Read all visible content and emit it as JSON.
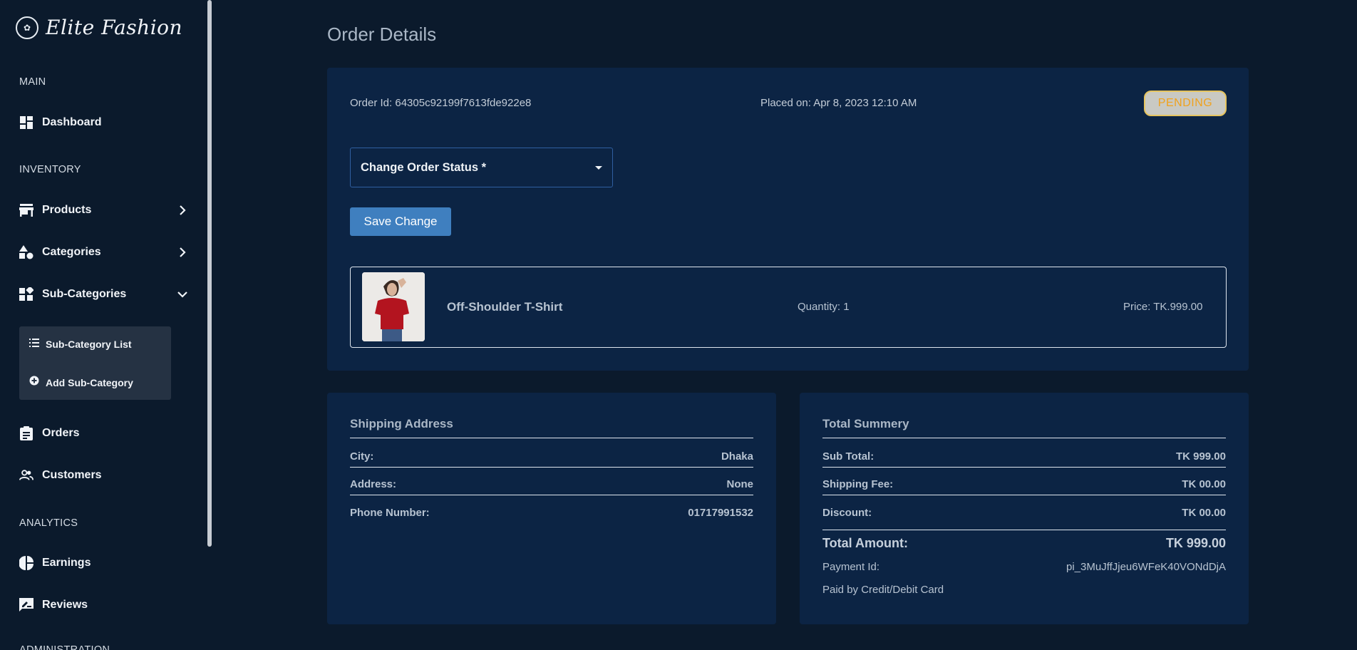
{
  "brand": {
    "name": "Elite Fashion"
  },
  "sidebar": {
    "sections": [
      "MAIN",
      "INVENTORY",
      "ANALYTICS",
      "ADMINISTRATION"
    ],
    "items": {
      "dashboard": "Dashboard",
      "products": "Products",
      "categories": "Categories",
      "subcategories": "Sub-Categories",
      "orders": "Orders",
      "customers": "Customers",
      "earnings": "Earnings",
      "reviews": "Reviews"
    },
    "submenu": {
      "list": "Sub-Category List",
      "add": "Add Sub-Category"
    }
  },
  "page": {
    "title": "Order Details"
  },
  "order": {
    "id_label": "Order Id: 64305c92199f7613fde922e8",
    "placed_label": "Placed on: Apr 8, 2023 12:10 AM",
    "status": "PENDING",
    "status_select_label": "Change Order Status *",
    "save_label": "Save Change",
    "item": {
      "name": "Off-Shoulder T-Shirt",
      "quantity": "Quantity: 1",
      "price": "Price: TK.999.00"
    }
  },
  "shipping": {
    "title": "Shipping Address",
    "rows": [
      {
        "label": "City:",
        "value": "Dhaka"
      },
      {
        "label": "Address:",
        "value": "None"
      },
      {
        "label": "Phone Number:",
        "value": "01717991532"
      }
    ]
  },
  "summary": {
    "title": "Total Summery",
    "rows": [
      {
        "label": "Sub Total:",
        "value": "TK 999.00"
      },
      {
        "label": "Shipping Fee:",
        "value": "TK 00.00"
      },
      {
        "label": "Discount:",
        "value": "TK 00.00"
      }
    ],
    "total_label": "Total Amount:",
    "total_value": "TK 999.00",
    "payment_label": "Payment Id:",
    "payment_value": "pi_3MuJffJjeu6WFeK40VONdDjA",
    "paid_by": "Paid by Credit/Debit Card"
  },
  "colors": {
    "background": "#0b1a2c",
    "card": "#0c2444",
    "accent_button": "#3f7fbf",
    "pending": "#f0a21e"
  }
}
